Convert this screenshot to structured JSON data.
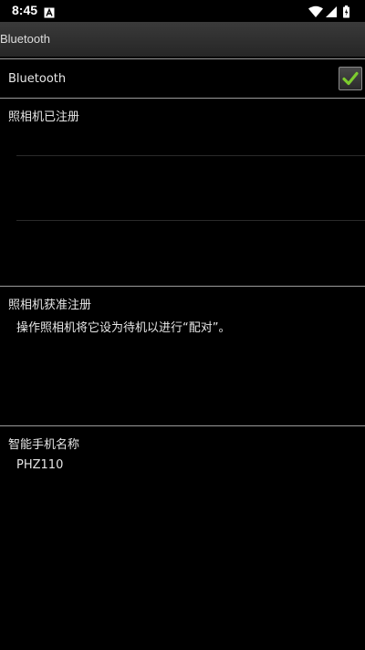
{
  "status_bar": {
    "time": "8:45",
    "notification_icon": "a-icon",
    "wifi_icon": "wifi-icon",
    "signal_icon": "signal-icon",
    "battery_icon": "battery-icon"
  },
  "action_bar": {
    "title": "Bluetooth"
  },
  "bluetooth_row": {
    "label": "Bluetooth",
    "checked": true,
    "check_color": "#7ccc2e"
  },
  "registered_section": {
    "title": "照相机已注册"
  },
  "pairing_section": {
    "title": "照相机获准注册",
    "description": "操作照相机将它设为待机以进行“配对”。"
  },
  "phone_name_section": {
    "title": "智能手机名称",
    "value": "PHZ110"
  }
}
